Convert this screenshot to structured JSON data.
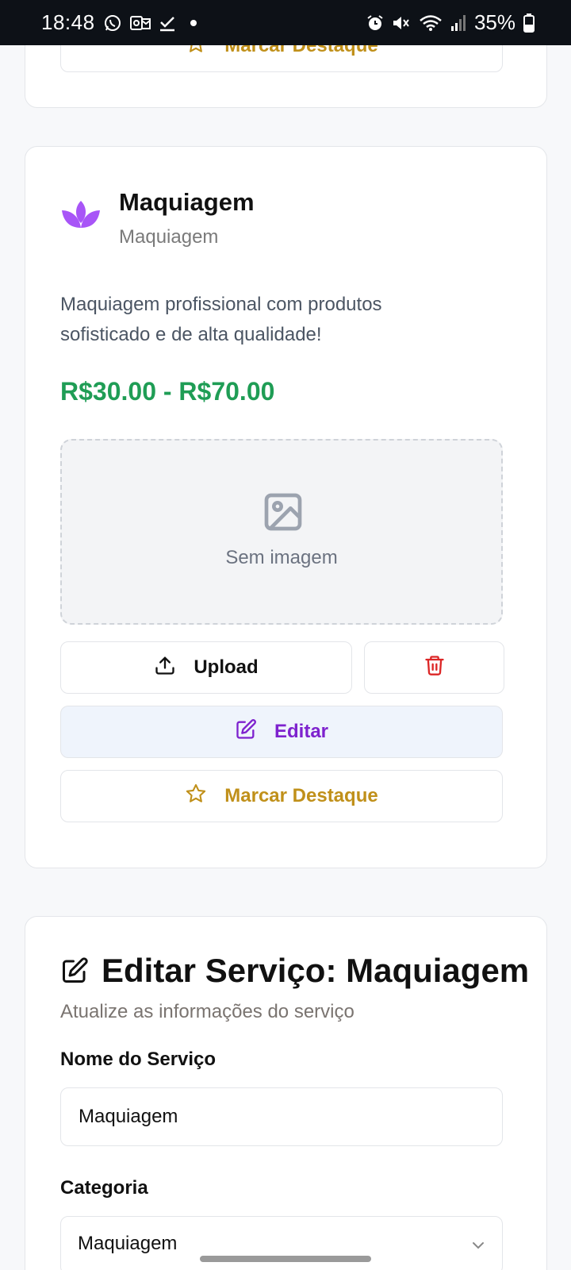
{
  "status_bar": {
    "time": "18:48",
    "battery": "35%",
    "icons": [
      "whatsapp-icon",
      "outlook-icon",
      "checkmark-icon",
      "dot-icon",
      "alarm-icon",
      "mute-icon",
      "wifi-icon",
      "signal-icon",
      "battery-icon"
    ]
  },
  "top_card": {
    "feature_label": "Marcar Destaque"
  },
  "service": {
    "icon": "lotus-icon",
    "name": "Maquiagem",
    "category": "Maquiagem",
    "description": "Maquiagem profissional com produtos sofisticado e de alta qualidade!",
    "price": "R$30.00 - R$70.00",
    "image_placeholder": "Sem imagem",
    "upload_label": "Upload",
    "edit_label": "Editar",
    "feature_label": "Marcar Destaque"
  },
  "edit_form": {
    "title": "Editar Serviço: Maquiagem",
    "subtitle": "Atualize as informações do serviço",
    "name_label": "Nome do Serviço",
    "name_value": "Maquiagem",
    "category_label": "Categoria",
    "category_value": "Maquiagem"
  },
  "colors": {
    "accent_purple": "#7e22ce",
    "lotus": "#a855f7",
    "gold": "#c0901a",
    "price_green": "#1f9d55",
    "delete_red": "#dc2626"
  }
}
